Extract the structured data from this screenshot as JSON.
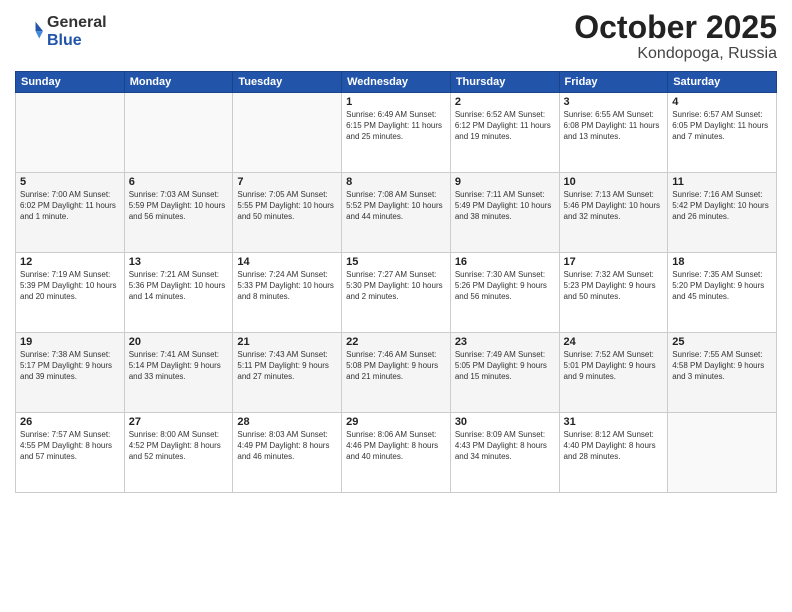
{
  "header": {
    "logo_general": "General",
    "logo_blue": "Blue",
    "month": "October 2025",
    "location": "Kondopoga, Russia"
  },
  "days_of_week": [
    "Sunday",
    "Monday",
    "Tuesday",
    "Wednesday",
    "Thursday",
    "Friday",
    "Saturday"
  ],
  "weeks": [
    [
      {
        "day": "",
        "info": ""
      },
      {
        "day": "",
        "info": ""
      },
      {
        "day": "",
        "info": ""
      },
      {
        "day": "1",
        "info": "Sunrise: 6:49 AM\nSunset: 6:15 PM\nDaylight: 11 hours\nand 25 minutes."
      },
      {
        "day": "2",
        "info": "Sunrise: 6:52 AM\nSunset: 6:12 PM\nDaylight: 11 hours\nand 19 minutes."
      },
      {
        "day": "3",
        "info": "Sunrise: 6:55 AM\nSunset: 6:08 PM\nDaylight: 11 hours\nand 13 minutes."
      },
      {
        "day": "4",
        "info": "Sunrise: 6:57 AM\nSunset: 6:05 PM\nDaylight: 11 hours\nand 7 minutes."
      }
    ],
    [
      {
        "day": "5",
        "info": "Sunrise: 7:00 AM\nSunset: 6:02 PM\nDaylight: 11 hours\nand 1 minute."
      },
      {
        "day": "6",
        "info": "Sunrise: 7:03 AM\nSunset: 5:59 PM\nDaylight: 10 hours\nand 56 minutes."
      },
      {
        "day": "7",
        "info": "Sunrise: 7:05 AM\nSunset: 5:55 PM\nDaylight: 10 hours\nand 50 minutes."
      },
      {
        "day": "8",
        "info": "Sunrise: 7:08 AM\nSunset: 5:52 PM\nDaylight: 10 hours\nand 44 minutes."
      },
      {
        "day": "9",
        "info": "Sunrise: 7:11 AM\nSunset: 5:49 PM\nDaylight: 10 hours\nand 38 minutes."
      },
      {
        "day": "10",
        "info": "Sunrise: 7:13 AM\nSunset: 5:46 PM\nDaylight: 10 hours\nand 32 minutes."
      },
      {
        "day": "11",
        "info": "Sunrise: 7:16 AM\nSunset: 5:42 PM\nDaylight: 10 hours\nand 26 minutes."
      }
    ],
    [
      {
        "day": "12",
        "info": "Sunrise: 7:19 AM\nSunset: 5:39 PM\nDaylight: 10 hours\nand 20 minutes."
      },
      {
        "day": "13",
        "info": "Sunrise: 7:21 AM\nSunset: 5:36 PM\nDaylight: 10 hours\nand 14 minutes."
      },
      {
        "day": "14",
        "info": "Sunrise: 7:24 AM\nSunset: 5:33 PM\nDaylight: 10 hours\nand 8 minutes."
      },
      {
        "day": "15",
        "info": "Sunrise: 7:27 AM\nSunset: 5:30 PM\nDaylight: 10 hours\nand 2 minutes."
      },
      {
        "day": "16",
        "info": "Sunrise: 7:30 AM\nSunset: 5:26 PM\nDaylight: 9 hours\nand 56 minutes."
      },
      {
        "day": "17",
        "info": "Sunrise: 7:32 AM\nSunset: 5:23 PM\nDaylight: 9 hours\nand 50 minutes."
      },
      {
        "day": "18",
        "info": "Sunrise: 7:35 AM\nSunset: 5:20 PM\nDaylight: 9 hours\nand 45 minutes."
      }
    ],
    [
      {
        "day": "19",
        "info": "Sunrise: 7:38 AM\nSunset: 5:17 PM\nDaylight: 9 hours\nand 39 minutes."
      },
      {
        "day": "20",
        "info": "Sunrise: 7:41 AM\nSunset: 5:14 PM\nDaylight: 9 hours\nand 33 minutes."
      },
      {
        "day": "21",
        "info": "Sunrise: 7:43 AM\nSunset: 5:11 PM\nDaylight: 9 hours\nand 27 minutes."
      },
      {
        "day": "22",
        "info": "Sunrise: 7:46 AM\nSunset: 5:08 PM\nDaylight: 9 hours\nand 21 minutes."
      },
      {
        "day": "23",
        "info": "Sunrise: 7:49 AM\nSunset: 5:05 PM\nDaylight: 9 hours\nand 15 minutes."
      },
      {
        "day": "24",
        "info": "Sunrise: 7:52 AM\nSunset: 5:01 PM\nDaylight: 9 hours\nand 9 minutes."
      },
      {
        "day": "25",
        "info": "Sunrise: 7:55 AM\nSunset: 4:58 PM\nDaylight: 9 hours\nand 3 minutes."
      }
    ],
    [
      {
        "day": "26",
        "info": "Sunrise: 7:57 AM\nSunset: 4:55 PM\nDaylight: 8 hours\nand 57 minutes."
      },
      {
        "day": "27",
        "info": "Sunrise: 8:00 AM\nSunset: 4:52 PM\nDaylight: 8 hours\nand 52 minutes."
      },
      {
        "day": "28",
        "info": "Sunrise: 8:03 AM\nSunset: 4:49 PM\nDaylight: 8 hours\nand 46 minutes."
      },
      {
        "day": "29",
        "info": "Sunrise: 8:06 AM\nSunset: 4:46 PM\nDaylight: 8 hours\nand 40 minutes."
      },
      {
        "day": "30",
        "info": "Sunrise: 8:09 AM\nSunset: 4:43 PM\nDaylight: 8 hours\nand 34 minutes."
      },
      {
        "day": "31",
        "info": "Sunrise: 8:12 AM\nSunset: 4:40 PM\nDaylight: 8 hours\nand 28 minutes."
      },
      {
        "day": "",
        "info": ""
      }
    ]
  ]
}
